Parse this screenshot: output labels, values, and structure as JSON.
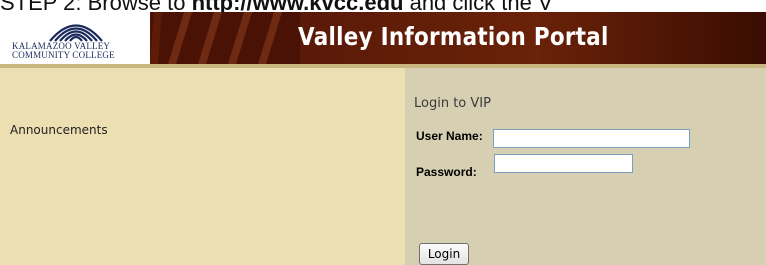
{
  "instruction": {
    "prefix": "STEP 2: Browse to ",
    "url": "http://www.kvcc.edu",
    "suffix": " and click the V"
  },
  "header": {
    "logo_line1": "KALAMAZOO VALLEY",
    "logo_line2": "COMMUNITY COLLEGE",
    "title": "Valley Information Portal"
  },
  "left": {
    "announcements": "Announcements"
  },
  "login": {
    "title": "Login to VIP",
    "username_label": "User Name:",
    "username_value": "",
    "password_label": "Password:",
    "password_value": "",
    "button_label": "Login"
  },
  "colors": {
    "banner": "#5a1a08",
    "left_panel": "#ecdfb2",
    "right_panel": "#d6cfb1",
    "logo_text": "#1b2a5c"
  },
  "icons": {
    "logo": "college-arches-logo"
  }
}
